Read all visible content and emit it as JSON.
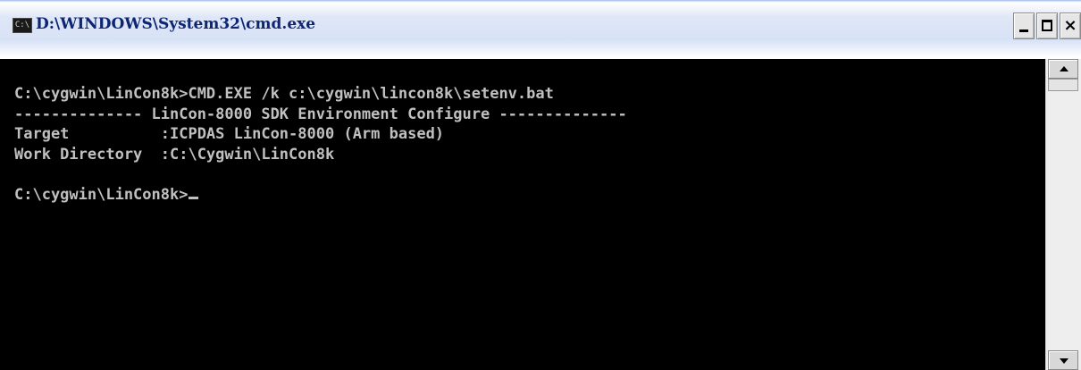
{
  "window": {
    "title": "D:\\WINDOWS\\System32\\cmd.exe",
    "icon_name": "cmd-icon",
    "icon_text": "C:\\"
  },
  "controls": {
    "minimize_icon": "minimize-icon",
    "maximize_icon": "maximize-icon",
    "close_icon": "close-icon",
    "close_glyph": "×"
  },
  "console": {
    "lines": [
      "C:\\cygwin\\LinCon8k>CMD.EXE /k c:\\cygwin\\lincon8k\\setenv.bat",
      "-------------- LinCon-8000 SDK Environment Configure --------------",
      "Target          :ICPDAS LinCon-8000 (Arm based)",
      "Work Directory  :C:\\Cygwin\\LinCon8k",
      "",
      "C:\\cygwin\\LinCon8k>"
    ]
  },
  "colors": {
    "console_background": "#000000",
    "console_text": "#c0c0c0",
    "title_text": "#0d2573"
  }
}
